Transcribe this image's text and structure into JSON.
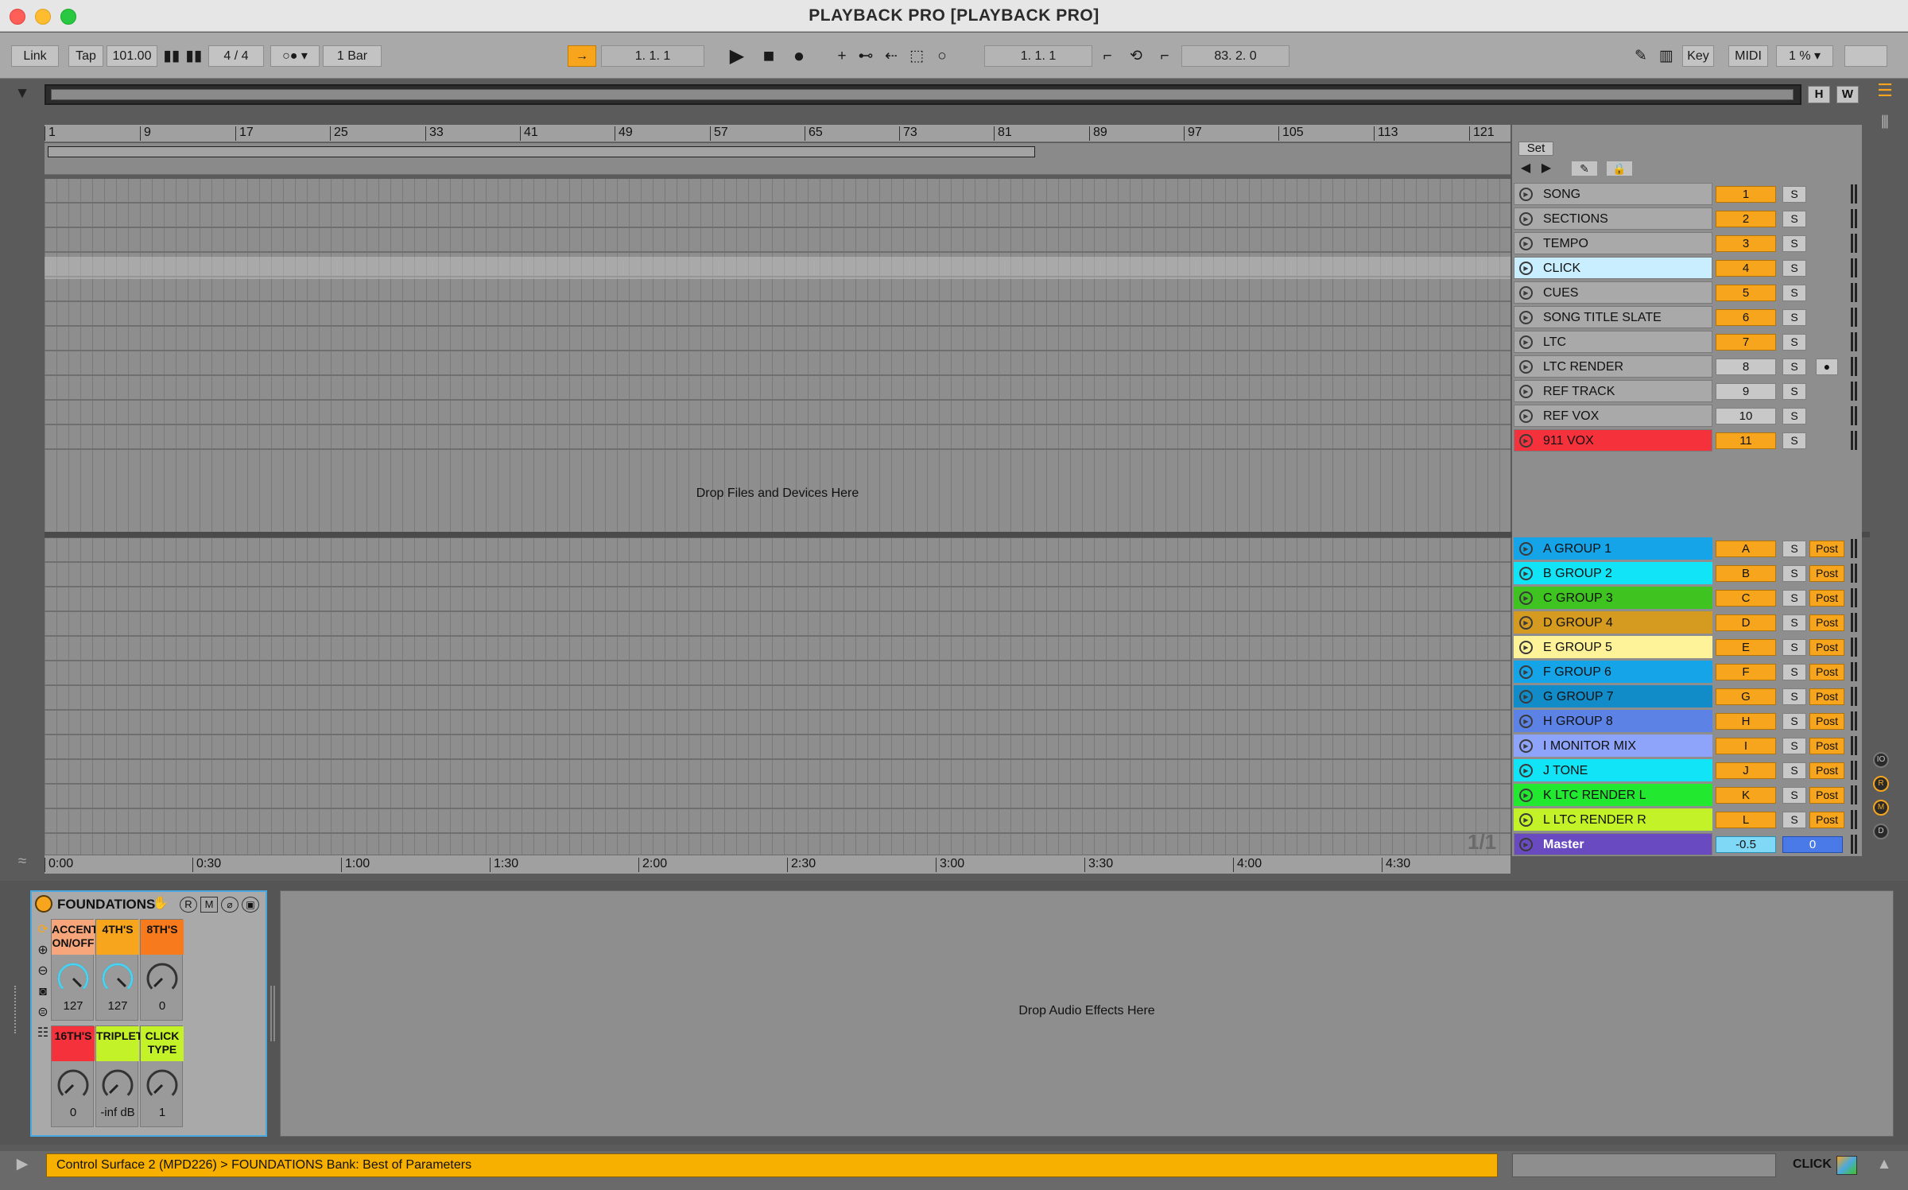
{
  "window": {
    "title": "PLAYBACK PRO  [PLAYBACK PRO]"
  },
  "controlbar": {
    "link": "Link",
    "tap": "Tap",
    "tempo": "101.00",
    "signature": "4 / 4",
    "quantize": "1 Bar",
    "arrangement_position": "1.   1.   1",
    "loop_start": "1.   1.   1",
    "loop_length": "83.   2.   0",
    "key": "Key",
    "midi": "MIDI",
    "cpu": "1 %"
  },
  "overview": {
    "h": "H",
    "w": "W"
  },
  "ruler": {
    "bars": [
      "1",
      "9",
      "17",
      "25",
      "33",
      "41",
      "49",
      "57",
      "65",
      "73",
      "81",
      "89",
      "97",
      "105",
      "113",
      "121"
    ],
    "times": [
      "0:00",
      "0:30",
      "1:00",
      "1:30",
      "2:00",
      "2:30",
      "3:00",
      "3:30",
      "4:00",
      "4:30"
    ]
  },
  "arrangement": {
    "drop_text": "Drop Files and Devices Here",
    "page_indicator": "1/1"
  },
  "tracks_panel": {
    "set_label": "Set",
    "tracks": [
      {
        "name": "SONG",
        "num": "1",
        "solo": "S",
        "color": "#a9a9a9"
      },
      {
        "name": "SECTIONS",
        "num": "2",
        "solo": "S",
        "color": "#a9a9a9"
      },
      {
        "name": "TEMPO",
        "num": "3",
        "solo": "S",
        "color": "#a9a9a9"
      },
      {
        "name": "CLICK",
        "num": "4",
        "solo": "S",
        "color": "#c9eeff"
      },
      {
        "name": "CUES",
        "num": "5",
        "solo": "S",
        "color": "#a9a9a9"
      },
      {
        "name": "SONG TITLE SLATE",
        "num": "6",
        "solo": "S",
        "color": "#a9a9a9"
      },
      {
        "name": "LTC",
        "num": "7",
        "solo": "S",
        "color": "#a9a9a9"
      },
      {
        "name": "LTC RENDER",
        "num": "8",
        "solo": "S",
        "color": "#a9a9a9"
      },
      {
        "name": "REF TRACK",
        "num": "9",
        "solo": "S",
        "color": "#a9a9a9"
      },
      {
        "name": "REF VOX",
        "num": "10",
        "solo": "S",
        "color": "#a9a9a9"
      },
      {
        "name": "911 VOX",
        "num": "11",
        "solo": "S",
        "color": "#f5323c"
      }
    ],
    "returns": [
      {
        "name": "A GROUP 1",
        "letter": "A",
        "solo": "S",
        "post": "Post",
        "color": "#16a4e8"
      },
      {
        "name": "B GROUP 2",
        "letter": "B",
        "solo": "S",
        "post": "Post",
        "color": "#10e4f6"
      },
      {
        "name": "C GROUP 3",
        "letter": "C",
        "solo": "S",
        "post": "Post",
        "color": "#3ec320"
      },
      {
        "name": "D GROUP 4",
        "letter": "D",
        "solo": "S",
        "post": "Post",
        "color": "#d59a20"
      },
      {
        "name": "E GROUP 5",
        "letter": "E",
        "solo": "S",
        "post": "Post",
        "color": "#fff39a"
      },
      {
        "name": "F GROUP 6",
        "letter": "F",
        "solo": "S",
        "post": "Post",
        "color": "#16a4e8"
      },
      {
        "name": "G GROUP 7",
        "letter": "G",
        "solo": "S",
        "post": "Post",
        "color": "#118cc9"
      },
      {
        "name": "H GROUP 8",
        "letter": "H",
        "solo": "S",
        "post": "Post",
        "color": "#5c82e6"
      },
      {
        "name": "I MONITOR MIX",
        "letter": "I",
        "solo": "S",
        "post": "Post",
        "color": "#8ea4fa"
      },
      {
        "name": "J TONE",
        "letter": "J",
        "solo": "S",
        "post": "Post",
        "color": "#10e4f6"
      },
      {
        "name": "K LTC RENDER L",
        "letter": "K",
        "solo": "S",
        "post": "Post",
        "color": "#22e830"
      },
      {
        "name": "L LTC RENDER R",
        "letter": "L",
        "solo": "S",
        "post": "Post",
        "color": "#c3f228"
      }
    ],
    "master": {
      "name": "Master",
      "volume": "-0.5",
      "pan": "0",
      "color": "#6a4ac0"
    }
  },
  "device": {
    "title": "FOUNDATIONS",
    "buttons": [
      "R",
      "M"
    ],
    "macros": [
      {
        "label": "ACCENT ON/OFF",
        "value": "127",
        "color": "#f6a67a",
        "knob_fraction": 1.0
      },
      {
        "label": "4TH'S",
        "value": "127",
        "color": "#f7a51c",
        "knob_fraction": 1.0
      },
      {
        "label": "8TH'S",
        "value": "0",
        "color": "#f77a1c",
        "knob_fraction": 0.0
      },
      {
        "label": "16TH'S",
        "value": "0",
        "color": "#f5323c",
        "knob_fraction": 0.0
      },
      {
        "label": "TRIPLET",
        "value": "-inf dB",
        "color": "#c3f228",
        "knob_fraction": 0.0
      },
      {
        "label": "CLICK TYPE",
        "value": "1",
        "color": "#c3f228",
        "knob_fraction": 0.0
      }
    ]
  },
  "effects": {
    "drop_text": "Drop Audio Effects Here"
  },
  "status": {
    "message": "Control Surface 2 (MPD226) > FOUNDATIONS Bank: Best of Parameters",
    "track": "CLICK"
  },
  "colors": {
    "accent": "#f7a51c",
    "selection": "#4aa8e0"
  }
}
